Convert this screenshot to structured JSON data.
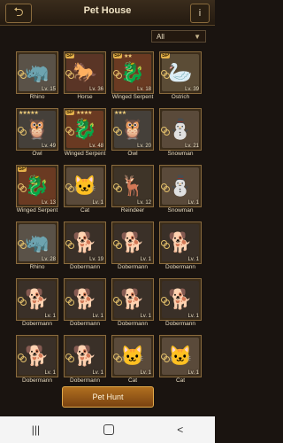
{
  "header": {
    "title": "Pet House",
    "back_icon": "back-arrow-icon",
    "info_label": "i"
  },
  "filter": {
    "selected": "All"
  },
  "pets": [
    {
      "name": "Rhino",
      "level": "Lv. 15",
      "badge": "none",
      "stars": "",
      "icon": "🦏",
      "bg": "#5a5248"
    },
    {
      "name": "Horse",
      "level": "Lv. 36",
      "badge": "SP",
      "stars": "",
      "icon": "🐎",
      "bg": "#5a3526"
    },
    {
      "name": "Winged Serpent",
      "level": "Lv. 18",
      "badge": "SP",
      "stars": "★★",
      "icon": "🐉",
      "bg": "#6a3a22"
    },
    {
      "name": "Ostrich",
      "level": "Lv. 39",
      "badge": "SP",
      "stars": "",
      "icon": "🦢",
      "bg": "#5b4c36"
    },
    {
      "name": "Owl",
      "level": "Lv. 49",
      "badge": "none",
      "stars": "★★★★★",
      "icon": "🦉",
      "bg": "#45403a"
    },
    {
      "name": "Winged Serpent",
      "level": "Lv. 48",
      "badge": "SP",
      "stars": "★★★★",
      "icon": "🐉",
      "bg": "#6a3a22"
    },
    {
      "name": "Owl",
      "level": "Lv. 20",
      "badge": "none",
      "stars": "★★★",
      "icon": "🦉",
      "bg": "#45403a"
    },
    {
      "name": "Snowman",
      "level": "Lv. 21",
      "badge": "none",
      "stars": "",
      "icon": "⛄",
      "bg": "#5a4a3a"
    },
    {
      "name": "Winged Serpent",
      "level": "Lv. 13",
      "badge": "SP",
      "stars": "",
      "icon": "🐉",
      "bg": "#6a3a22"
    },
    {
      "name": "Cat",
      "level": "Lv. 1",
      "badge": "none",
      "stars": "",
      "icon": "🐱",
      "bg": "#5a4a3a"
    },
    {
      "name": "Reindeer",
      "level": "Lv. 12",
      "badge": "none",
      "stars": "",
      "icon": "🦌",
      "bg": "#3e3428"
    },
    {
      "name": "Snowman",
      "level": "Lv. 1",
      "badge": "none",
      "stars": "",
      "icon": "⛄",
      "bg": "#5a4a3a"
    },
    {
      "name": "Rhino",
      "level": "Lv. 28",
      "badge": "none",
      "stars": "",
      "icon": "🦏",
      "bg": "#5a5248"
    },
    {
      "name": "Dobermann",
      "level": "Lv. 19",
      "badge": "none",
      "stars": "",
      "icon": "🐕",
      "bg": "#3a3028"
    },
    {
      "name": "Dobermann",
      "level": "Lv. 1",
      "badge": "none",
      "stars": "",
      "icon": "🐕",
      "bg": "#3a3028"
    },
    {
      "name": "Dobermann",
      "level": "Lv. 1",
      "badge": "none",
      "stars": "",
      "icon": "🐕",
      "bg": "#3a3028"
    },
    {
      "name": "Dobermann",
      "level": "Lv. 1",
      "badge": "none",
      "stars": "",
      "icon": "🐕",
      "bg": "#3a3028"
    },
    {
      "name": "Dobermann",
      "level": "Lv. 1",
      "badge": "none",
      "stars": "",
      "icon": "🐕",
      "bg": "#3a3028"
    },
    {
      "name": "Dobermann",
      "level": "Lv. 1",
      "badge": "none",
      "stars": "",
      "icon": "🐕",
      "bg": "#3a3028"
    },
    {
      "name": "Dobermann",
      "level": "Lv. 1",
      "badge": "none",
      "stars": "",
      "icon": "🐕",
      "bg": "#3a3028"
    },
    {
      "name": "Dobermann",
      "level": "Lv. 1",
      "badge": "none",
      "stars": "",
      "icon": "🐕",
      "bg": "#3a3028"
    },
    {
      "name": "Dobermann",
      "level": "Lv. 1",
      "badge": "none",
      "stars": "",
      "icon": "🐕",
      "bg": "#3a3028"
    },
    {
      "name": "Cat",
      "level": "Lv. 1",
      "badge": "none",
      "stars": "",
      "icon": "🐱",
      "bg": "#5a4a3a"
    },
    {
      "name": "Cat",
      "level": "Lv. 1",
      "badge": "none",
      "stars": "",
      "icon": "🐱",
      "bg": "#5a4a3a"
    }
  ],
  "action": {
    "pet_hunt": "Pet Hunt"
  },
  "system_nav": {
    "recents": "|||",
    "back": "<"
  }
}
